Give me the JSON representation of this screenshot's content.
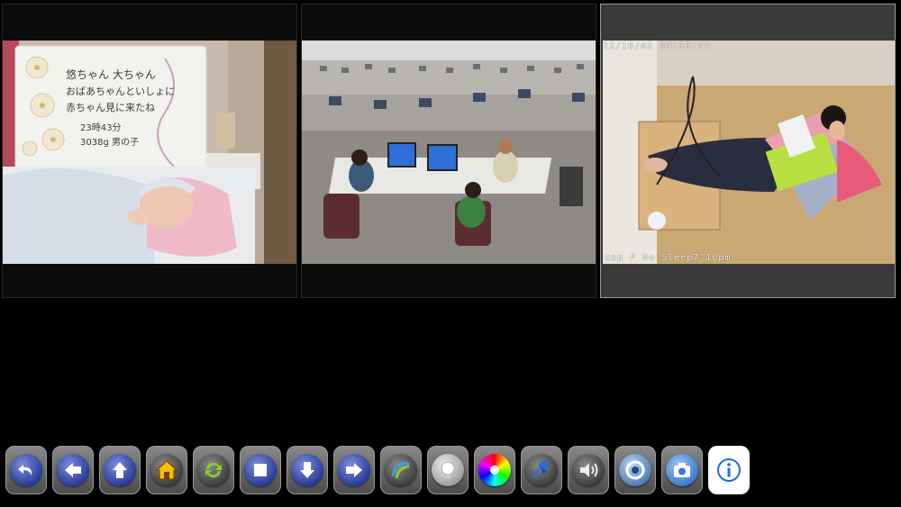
{
  "cameras": [
    {
      "id": "camera-1",
      "overlay_text": "",
      "note_lines": [
        "悠ちゃん 大ちゃん",
        "おばあちゃんといしょに",
        "赤ちゃん見に来たね",
        "23時43分",
        "3038g 男の子"
      ]
    },
    {
      "id": "camera-2",
      "overlay_text": ""
    },
    {
      "id": "camera-3",
      "timestamp": "12/10/02 04:30:21",
      "caption": "cop P No Sleep7'10pm",
      "selected": true
    }
  ],
  "toolbar": {
    "buttons": [
      {
        "name": "back-icon"
      },
      {
        "name": "arrow-left-icon"
      },
      {
        "name": "arrow-up-icon"
      },
      {
        "name": "home-icon"
      },
      {
        "name": "refresh-icon"
      },
      {
        "name": "stop-icon"
      },
      {
        "name": "arrow-down-icon"
      },
      {
        "name": "arrow-right-icon"
      },
      {
        "name": "patrol-icon"
      },
      {
        "name": "focus-icon"
      },
      {
        "name": "color-wheel-icon"
      },
      {
        "name": "pin-icon"
      },
      {
        "name": "speaker-icon"
      },
      {
        "name": "iris-icon"
      },
      {
        "name": "camera-snapshot-icon"
      },
      {
        "name": "info-icon"
      }
    ]
  },
  "colors": {
    "background": "#000000",
    "button_blue": "#2b3d9a",
    "selected_panel": "#3a3a3a"
  }
}
